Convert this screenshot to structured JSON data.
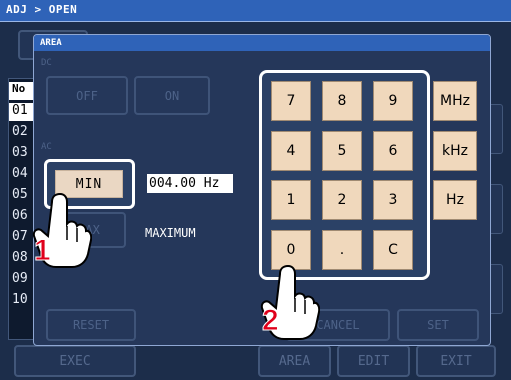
{
  "header": {
    "breadcrumb": "ADJ > OPEN"
  },
  "background": {
    "list_header": "No",
    "list_items": [
      "01",
      "02",
      "03",
      "04",
      "05",
      "06",
      "07",
      "08",
      "09",
      "10"
    ],
    "bottom_buttons": [
      "EXEC",
      "AREA",
      "EDIT",
      "EXIT"
    ]
  },
  "dialog": {
    "title": "AREA",
    "section_label_dc": "DC",
    "section_label_ac": "AC",
    "off_label": "OFF",
    "on_label": "ON",
    "min_label": "MIN",
    "max_label_faded": "MAX",
    "freq_value": "004.00 Hz",
    "maximum_label": "MAXIMUM",
    "reset_label": "RESET",
    "cancel_label": "CANCEL",
    "set_label": "SET"
  },
  "keypad": {
    "rows": [
      [
        "7",
        "8",
        "9"
      ],
      [
        "4",
        "5",
        "6"
      ],
      [
        "1",
        "2",
        "3"
      ],
      [
        "0",
        ".",
        "C"
      ]
    ],
    "units": [
      "MHz",
      "kHz",
      "Hz"
    ]
  },
  "callouts": {
    "step1": "1",
    "step2": "2"
  },
  "colors": {
    "title_bar": "#2f63b8",
    "key_face": "#f0d8bc",
    "dialog_bg": "#25375a",
    "callout": "#e0001b"
  }
}
